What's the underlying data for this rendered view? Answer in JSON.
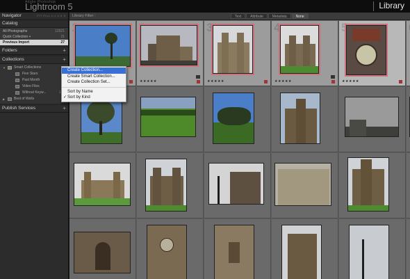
{
  "app": {
    "brand_small": "Adobe Photoshop",
    "brand": "Lightroom 5",
    "module": "Library"
  },
  "left": {
    "navigator": {
      "label": "Navigator",
      "zoom": "FIT  FILL  1:1  1:4  ⇕"
    },
    "catalog": {
      "label": "Catalog",
      "items": [
        {
          "label": "All Photographs",
          "count": "12921"
        },
        {
          "label": "Quick Collection +",
          "count": "21"
        },
        {
          "label": "Previous Import",
          "count": "27"
        }
      ]
    },
    "folders": {
      "label": "Folders",
      "plus": "+"
    },
    "collections": {
      "label": "Collections",
      "plus": "+",
      "items": [
        {
          "label": "Smart Collections",
          "count": ""
        },
        {
          "label": "Five Stars",
          "count": ""
        },
        {
          "label": "Past Month",
          "count": ""
        },
        {
          "label": "Video Files",
          "count": ""
        },
        {
          "label": "Without Keyw...",
          "count": "1284"
        },
        {
          "label": "Best of Wells",
          "count": ""
        }
      ]
    },
    "publish": {
      "label": "Publish Services",
      "plus": "+"
    }
  },
  "filterbar": {
    "title": "Library Filter :",
    "tabs": [
      "Text",
      "Attribute",
      "Metadata",
      "None"
    ],
    "active": "None"
  },
  "grid": {
    "indices": [
      "1",
      "2",
      "3",
      "4",
      "5",
      "6",
      "",
      "",
      "",
      "",
      "",
      "",
      "",
      "",
      "",
      "",
      "",
      "",
      "",
      "",
      "",
      "",
      "",
      "",
      "",
      "",
      ""
    ],
    "stars": "★★★★★"
  },
  "menu": {
    "items": [
      {
        "label": "Create Collection...",
        "highlighted": true
      },
      {
        "label": "Create Smart Collection..."
      },
      {
        "label": "Create Collection Set..."
      },
      {
        "label": "Sort by Name"
      },
      {
        "label": "Sort by Kind",
        "checked": true
      }
    ],
    "check": "✓"
  }
}
